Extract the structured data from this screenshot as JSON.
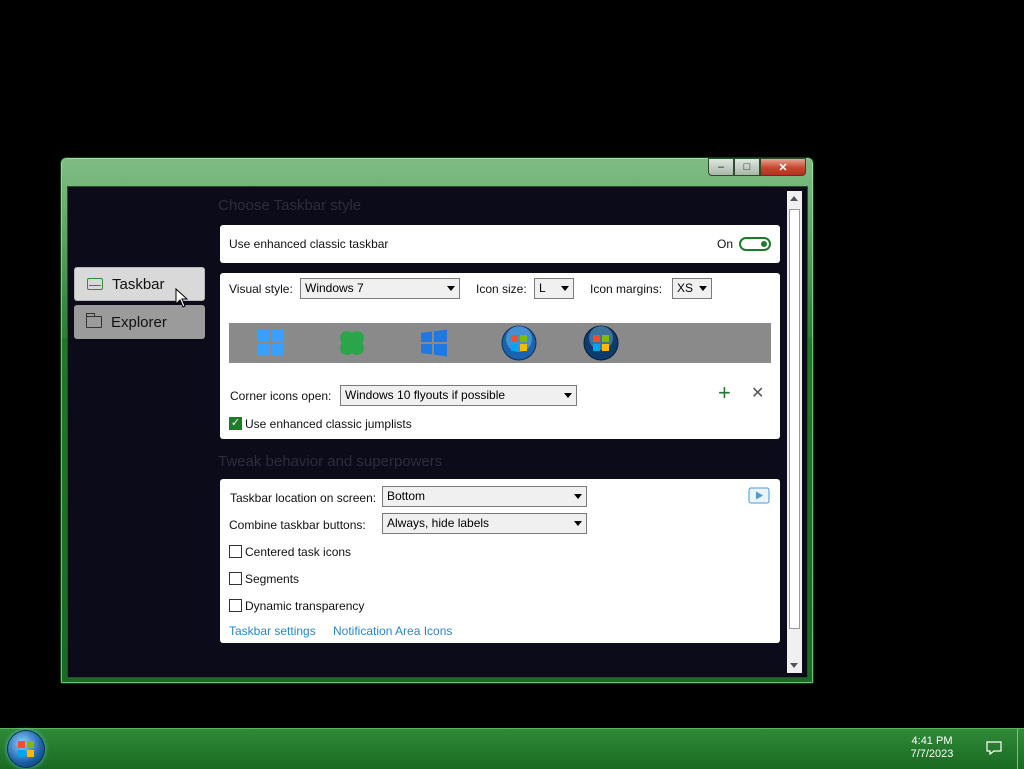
{
  "window": {
    "caption_buttons": {
      "minimize": "–",
      "maximize": "□",
      "close": "✕"
    }
  },
  "sidebar": {
    "items": [
      {
        "label": "Taskbar",
        "icon": "taskbar-icon",
        "selected": true
      },
      {
        "label": "Explorer",
        "icon": "folder-icon",
        "selected": false
      }
    ]
  },
  "style_section": {
    "title": "Choose Taskbar style",
    "enhanced": {
      "label": "Use enhanced classic taskbar",
      "state_label": "On",
      "enabled": true
    },
    "visual_style": {
      "label": "Visual style:",
      "value": "Windows 7"
    },
    "icon_size": {
      "label": "Icon size:",
      "value": "L"
    },
    "icon_margins": {
      "label": "Icon margins:",
      "value": "XS"
    },
    "preview_icons": [
      "windows-11-start-icon",
      "clover-icon",
      "windows-10-start-icon",
      "windows-7-orb-icon",
      "windows-vista-orb-icon"
    ],
    "corner_icons": {
      "label": "Corner icons open:",
      "value": "Windows 10 flyouts if possible"
    },
    "add_glyph": "+",
    "remove_glyph": "✕",
    "jumplists": {
      "label": "Use enhanced classic jumplists",
      "checked": true
    }
  },
  "tweak_section": {
    "title": "Tweak behavior and superpowers",
    "location": {
      "label": "Taskbar location on screen:",
      "value": "Bottom"
    },
    "combine": {
      "label": "Combine taskbar buttons:",
      "value": "Always, hide labels"
    },
    "centered": {
      "label": "Centered task icons",
      "checked": false
    },
    "segments": {
      "label": "Segments",
      "checked": false
    },
    "transparency": {
      "label": "Dynamic transparency",
      "checked": false
    },
    "links": {
      "taskbar_settings": "Taskbar settings",
      "notification_icons": "Notification Area Icons"
    }
  },
  "taskbar": {
    "time": "4:41 PM",
    "date": "7/7/2023"
  },
  "colors": {
    "accent": "#1f7a2b",
    "link": "#2a86c9",
    "taskbar": "#1f7a2a"
  }
}
